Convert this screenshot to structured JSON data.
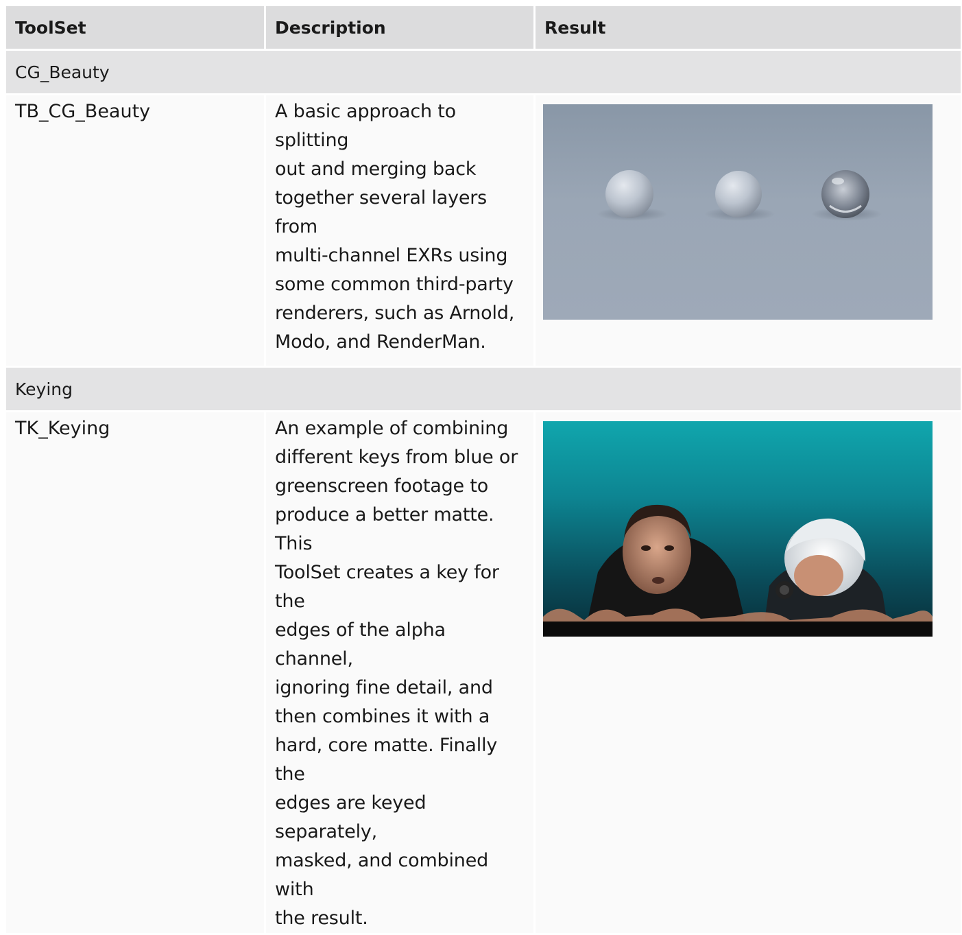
{
  "headers": {
    "toolset": "ToolSet",
    "description": "Description",
    "result": "Result"
  },
  "sections": [
    {
      "title": "CG_Beauty",
      "row": {
        "toolset": "TB_CG_Beauty",
        "description_lines": [
          "A basic approach to splitting",
          "out and merging back",
          "together several layers from",
          "multi-channel EXRs using",
          "some common third-party",
          "renderers, such as Arnold,",
          "Modo, and RenderMan."
        ]
      }
    },
    {
      "title": "Keying",
      "row": {
        "toolset": "TK_Keying",
        "description_lines": [
          "An example of combining",
          "different keys from blue or",
          "greenscreen footage to",
          "produce a better matte. This",
          "ToolSet creates a key for the",
          "edges of the alpha channel,",
          "ignoring fine detail, and",
          "then combines it with a",
          "hard, core matte. Finally the",
          "edges are keyed separately,",
          "masked, and combined with",
          "the result."
        ]
      }
    }
  ],
  "colors": {
    "header_bg": "#dcdcdd",
    "section_bg": "#e3e3e4",
    "row_bg": "#fafafa"
  }
}
